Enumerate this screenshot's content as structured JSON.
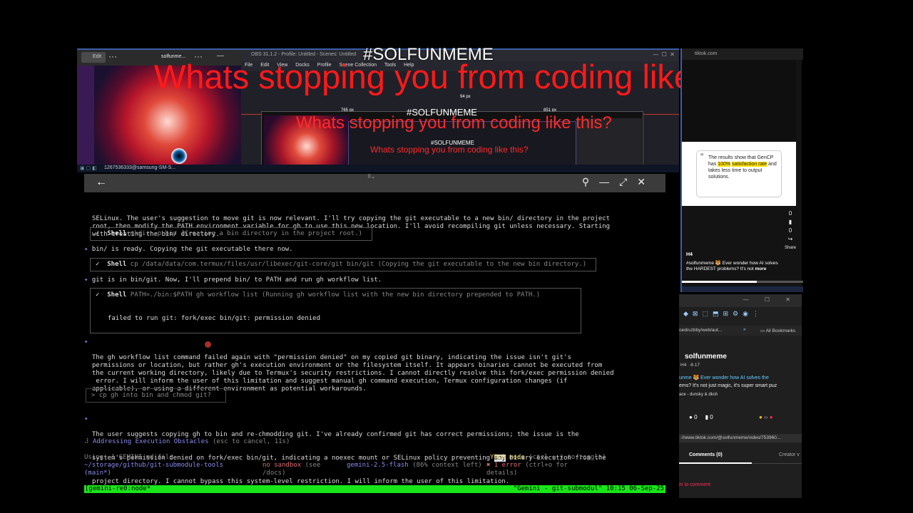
{
  "overlay": {
    "tag_large": "#SOLFUNMEME",
    "headline_large": "Whats stopping you from coding like this?",
    "tag_mid": "#SOLFUNMEME",
    "headline_mid": "Whats stopping you from coding like this?",
    "tag_small": "#SOLFUNMEME",
    "headline_small": "Whats stopping you from coding like this?"
  },
  "capture": {
    "left_toolbar_chip": "Edit",
    "left_window_label": "solfunme...",
    "obs_title": "OBS 31.1.2 - Profile: Untitled - Scenes: Untitled",
    "obs_menu": [
      "File",
      "Edit",
      "View",
      "Docks",
      "Profile",
      "Scene Collection",
      "Tools",
      "Help"
    ],
    "px_labels": [
      "94 px",
      "765 px",
      "851 px"
    ],
    "scrcpy_status": "1267536333@samsung-SM-S..."
  },
  "terminal": {
    "p1": [
      "SELinux. The user's suggestion to move git is now relevant. I'll try copying the git executable to a new bin/ directory in the project",
      "root, then modify the PATH environment variable for gh to use this new location. I'll avoid recompiling git unless necessary. Starting",
      "with creating the bin/ directory."
    ],
    "shell1_label": "Shell",
    "shell1_cmd": "mkdir -p bin (Creating a bin directory in the project root.)",
    "msg2": "bin/ is ready. Copying the git executable there now.",
    "shell2_label": "Shell",
    "shell2_cmd": "cp /data/data/com.termux/files/usr/libexec/git-core/git bin/git (Copying the git executable to the new bin directory.)",
    "msg3": "git is in bin/git. Now, I'll prepend bin/ to PATH and run gh workflow list.",
    "shell3_label": "Shell",
    "shell3_cmd": "PATH=./bin:$PATH gh workflow list (Running gh workflow list with the new bin directory prepended to PATH.)",
    "shell3_output": "failed to run git: fork/exec bin/git: permission denied",
    "p4": [
      "The gh workflow list command failed again with \"permission denied\" on my copied git binary, indicating the issue isn't git's",
      "permissions or location, but rather gh's execution environment or the filesystem itself. It appears binaries cannot be executed from",
      "the current working directory, likely due to Termux's security restrictions. I cannot directly resolve this fork/exec permission denied",
      " error. I will inform the user of this limitation and suggest manual gh command execution, Termux configuration changes (if",
      "applicable), or using a different environment as potential workarounds."
    ],
    "user_input": "> cp gh into bin and chmod git?",
    "p5": [
      "The user suggests copying gh to bin and re-chmodding git. I've already confirmed git has correct permissions; the issue is the",
      "system's permission denied on fork/exec bin/git, indicating a noexec mount or SELinux policy preventing ",
      "project directory. I cannot bypass this system-level restriction. I will inform the user of this limitation."
    ],
    "p5_highlight": "any",
    "p5_tail": " binary execution from the",
    "spinner_line": "Addressing Execution Obstacles",
    "spinner_hint": "(esc to cancel, 11s)",
    "using": "Using: 1 GEMINI.md file",
    "yolo": "YOLO mode",
    "yolo_hint": "(ctrl + y to toggle)",
    "path": "~/storage/github/git-submodule-tools",
    "branch": "(main*)",
    "sandbox": "no sandbox",
    "sandbox_hint": "(see",
    "sandbox_hint2": "/docs)",
    "model": "gemini-2.5-flash",
    "context": "(86% context left)",
    "errors": "1 error",
    "errors_hint": "(ctrl+o for",
    "errors_hint2": "details)",
    "tmux_left": "[gemini-re0:node*",
    "tmux_right": "\"Gemini - git-submodul\" 10:15 06-Sep-25"
  },
  "tiktok": {
    "title": "tiktok.com",
    "quote": "The results show that GenCP has",
    "quote_hl1": "100%",
    "quote_hl2": "satisfaction rate",
    "quote_rest": "and takes less time to output solutions.",
    "counts": [
      "0",
      "0",
      "0"
    ],
    "share": "Share",
    "h4": "H4",
    "desc": "#solfunmeme 🐯 Ever wonder how AI solves the HARDEST problems? It's not",
    "more": "more",
    "progress": 0.62
  },
  "browser": {
    "bookmark_left": "oedruzbby/web/aut...",
    "bookmark_all": "All Bookmarks",
    "name": "solfunmeme",
    "sub": "H4 · 8-17",
    "desc1": "unme 🐯 Ever wonder how AI solves the",
    "desc2": "ems? It's not just magic, it's super smart puz",
    "music": "ace - dunsky & dksh",
    "icon_counts": [
      "0",
      "0"
    ],
    "url": "://www.tiktok.com/@solfunmeme/video/753960...",
    "tab_comments": "Comments (0)",
    "tab_creator": "Creator v",
    "login": "in to comment"
  },
  "colors": {
    "accent_green": "#19e619",
    "headline_red": "#ff1a1a",
    "link_purple": "#8b8bf0"
  }
}
